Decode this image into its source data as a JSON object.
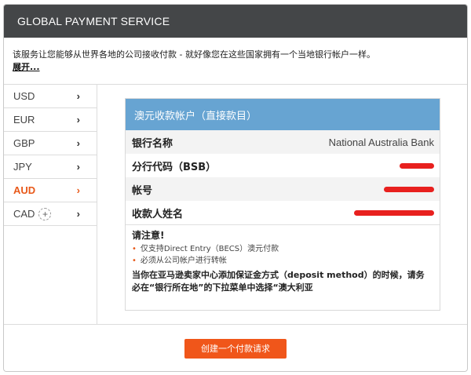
{
  "header": {
    "title": "GLOBAL PAYMENT SERVICE"
  },
  "intro": {
    "text": "该服务让您能够从世界各地的公司接收付款 - 就好像您在这些国家拥有一个当地银行帐户一样。",
    "expand_label": "展开..."
  },
  "currencies": [
    {
      "code": "USD",
      "chevron": "›"
    },
    {
      "code": "EUR",
      "chevron": "›"
    },
    {
      "code": "GBP",
      "chevron": "›"
    },
    {
      "code": "JPY",
      "chevron": "›"
    },
    {
      "code": "AUD",
      "chevron": "›",
      "active": true
    },
    {
      "code": "CAD",
      "chevron": "›",
      "plus": "+"
    }
  ],
  "account_card": {
    "title": "澳元收款帐户（直接款目）",
    "rows": [
      {
        "label": "银行名称",
        "value": "National Australia Bank"
      },
      {
        "label": "分行代码（BSB）",
        "value": ""
      },
      {
        "label": "帐号",
        "value": ""
      },
      {
        "label": "收款人姓名",
        "value": ""
      }
    ],
    "notice": {
      "title": "请注意!",
      "bullets": [
        "仅支持Direct Entry（BECS）澳元付款",
        "必须从公司帐户进行转帐"
      ],
      "bullet_marker": "•",
      "warning": "当你在亚马逊卖家中心添加保证金方式（deposit method）的时候，请务必在“银行所在地”的下拉菜单中选择“澳大利亚"
    }
  },
  "footer": {
    "create_button_label": "创建一个付款请求"
  },
  "colors": {
    "header_bg": "#444648",
    "accent_orange": "#f0561a",
    "card_header_blue": "#67a4d2",
    "redaction_red": "#e8201e"
  }
}
